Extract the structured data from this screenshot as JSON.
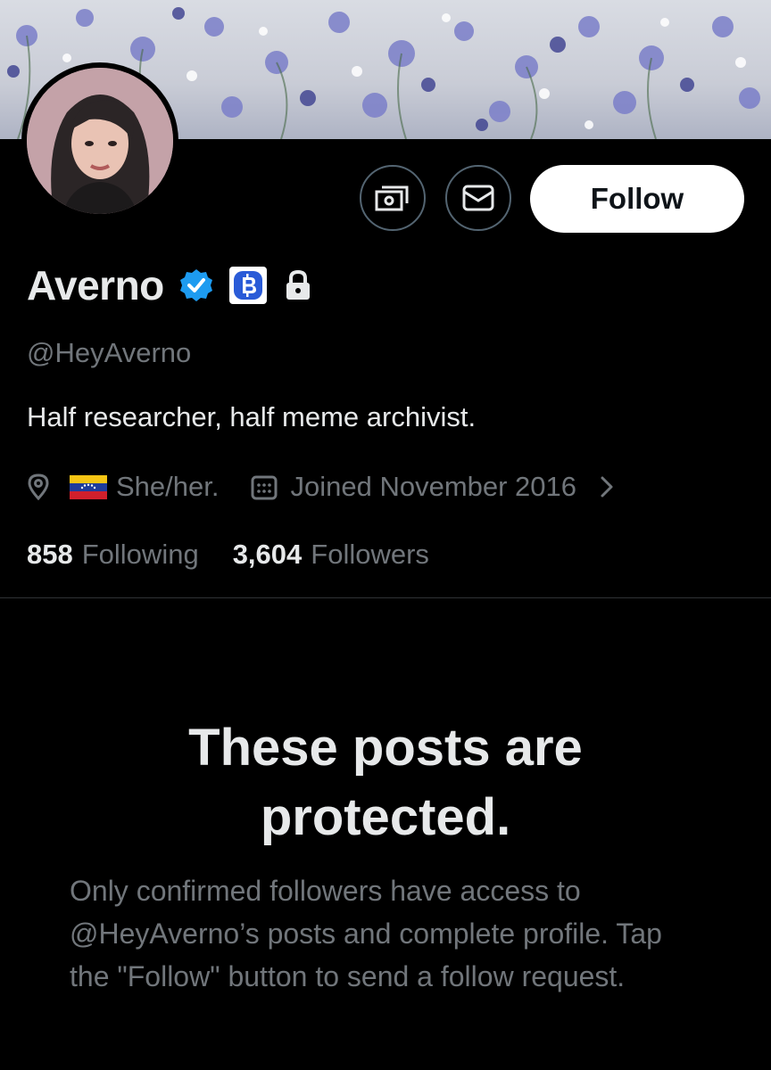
{
  "profile": {
    "display_name": "Averno",
    "handle": "@HeyAverno",
    "bio": "Half researcher, half meme archivist.",
    "pronouns": "She/her.",
    "joined": "Joined November 2016",
    "following_count": "858",
    "following_label": "Following",
    "followers_count": "3,604",
    "followers_label": "Followers"
  },
  "actions": {
    "follow_label": "Follow",
    "tip_icon": "money-icon",
    "message_icon": "envelope-icon"
  },
  "badges": {
    "verified_icon": "verified-badge-icon",
    "crypto_icon": "bitcoin-badge-icon",
    "lock_icon": "lock-icon"
  },
  "protected": {
    "title": "These posts are protected.",
    "body": "Only confirmed followers have access to @HeyAverno’s posts and complete profile. Tap the \"Follow\" button to send a follow request."
  },
  "colors": {
    "background": "#000000",
    "text_primary": "#e7e9ea",
    "text_secondary": "#71767b",
    "verified_blue": "#1d9bf0",
    "border": "#536471"
  }
}
